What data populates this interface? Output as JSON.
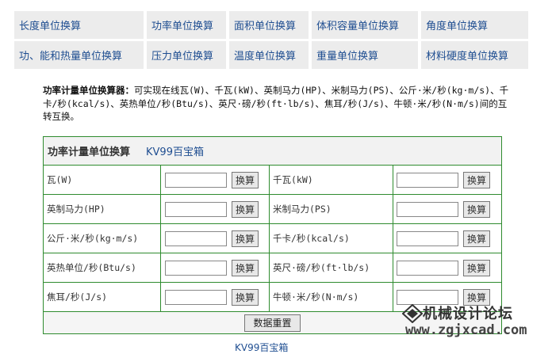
{
  "nav": {
    "row1": [
      "长度单位换算",
      "功率单位换算",
      "面积单位换算",
      "体积容量单位换算",
      "角度单位换算"
    ],
    "row2": [
      "功、能和热量单位换算",
      "压力单位换算",
      "温度单位换算",
      "重量单位换算",
      "材料硬度单位换算"
    ]
  },
  "description": {
    "title": "功率计量单位换算器：",
    "text": "可实现在线瓦(W)、千瓦(kW)、英制马力(HP)、米制马力(PS)、公斤·米/秒(kg·m/s)、千卡/秒(kcal/s)、英热单位/秒(Btu/s)、英尺·磅/秒(ft·lb/s)、焦耳/秒(J/s)、牛顿·米/秒(N·m/s)间的互转互换。"
  },
  "converter": {
    "title": "功率计量单位换算",
    "link": "KV99百宝箱",
    "button_label": "换算",
    "reset_label": "数据重置",
    "rows": [
      {
        "left": "瓦(W)",
        "right": "千瓦(kW)",
        "left_value": "",
        "right_value": ""
      },
      {
        "left": "英制马力(HP)",
        "right": "米制马力(PS)",
        "left_value": "",
        "right_value": ""
      },
      {
        "left": "公斤·米/秒(kg·m/s)",
        "right": "千卡/秒(kcal/s)",
        "left_value": "",
        "right_value": ""
      },
      {
        "left": "英热单位/秒(Btu/s)",
        "right": "英尺·磅/秒(ft·lb/s)",
        "left_value": "",
        "right_value": ""
      },
      {
        "left": "焦耳/秒(J/s)",
        "right": "牛顿·米/秒(N·m/s)",
        "left_value": "",
        "right_value": ""
      }
    ]
  },
  "watermark": {
    "brand": "机械设计论坛",
    "url": "www.zgjxcad.com"
  },
  "bottom_link": "KV99百宝箱"
}
